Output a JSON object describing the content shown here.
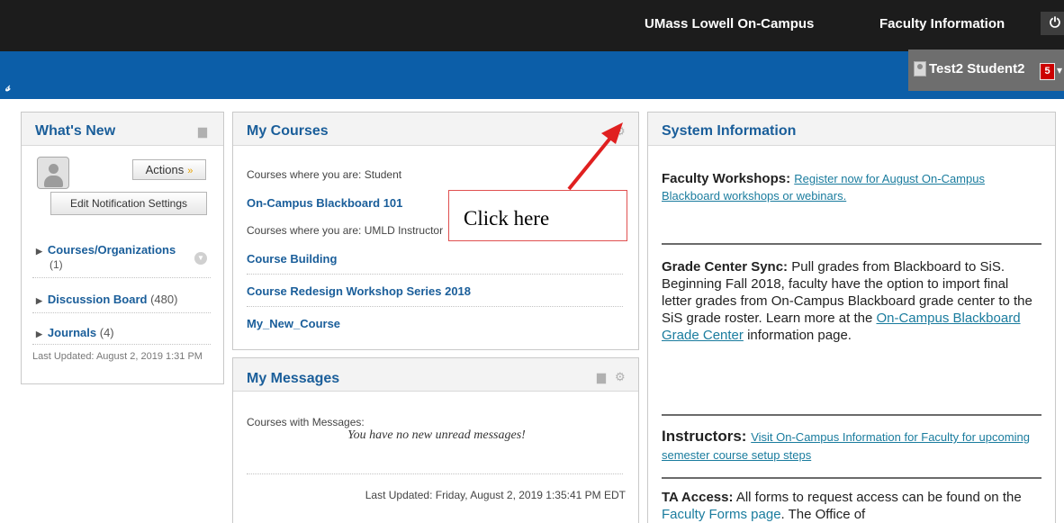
{
  "topnav": {
    "oncampus": "UMass Lowell On-Campus",
    "faculty": "Faculty Information",
    "power_glyph": "⏻"
  },
  "user": {
    "name": "Test2 Student2",
    "notification_count": "5"
  },
  "whats_new": {
    "title": "What's New",
    "actions_label": "Actions",
    "edit_settings_label": "Edit Notification Settings",
    "items": [
      {
        "label": "Courses/Organizations",
        "count": "(1)"
      },
      {
        "label": "Discussion Board",
        "count": "(480)"
      },
      {
        "label": "Journals",
        "count": "(4)"
      }
    ],
    "last_updated": "Last Updated: August 2, 2019 1:31 PM"
  },
  "my_courses": {
    "title": "My Courses",
    "student_label": "Courses where you are: Student",
    "student_courses": [
      "On-Campus Blackboard 101"
    ],
    "instructor_label": "Courses where you are: UMLD Instructor",
    "instructor_courses": [
      "Course Building",
      "Course Redesign Workshop Series 2018",
      "My_New_Course"
    ]
  },
  "my_messages": {
    "title": "My Messages",
    "label": "Courses with Messages:",
    "empty_text": "You have no new unread messages!",
    "last_updated": "Last Updated: Friday, August 2, 2019 1:35:41 PM EDT"
  },
  "system_info": {
    "title": "System Information",
    "workshops_heading": "Faculty Workshops:",
    "workshops_link": "Register now for August On-Campus Blackboard workshops or webinars.",
    "grade_heading": "Grade Center Sync:",
    "grade_text": "Pull grades from Blackboard to SiS. Beginning Fall 2018, faculty have the option to import final letter grades from On-Campus Blackboard grade center to the SiS grade roster. Learn more at the",
    "grade_link": "On-Campus Blackboard Grade Center",
    "grade_tail": "information page.",
    "instructors_heading": "Instructors:",
    "instructors_link": "Visit On-Campus Information for Faculty for upcoming semester course setup steps",
    "ta_heading": "TA Access:",
    "ta_text": "All forms to request access can be found on the",
    "ta_link": "Faculty Forms page",
    "ta_tail": ". The Office of"
  },
  "annotation": {
    "text": "Click here",
    "color": "#e02020"
  },
  "colors": {
    "topbar": "#1c1c1c",
    "bluebar": "#0c5ea8",
    "link": "#1a5e9a",
    "badge": "#cc0000"
  }
}
